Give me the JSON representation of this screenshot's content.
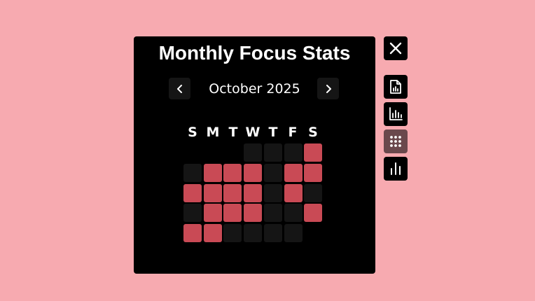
{
  "title": "Monthly Focus Stats",
  "calendar": {
    "month_label": "October 2025",
    "prev_icon": "chevron-left-icon",
    "next_icon": "chevron-right-icon",
    "weekdays": [
      "S",
      "M",
      "T",
      "W",
      "T",
      "F",
      "S"
    ],
    "first_weekday_index": 3,
    "days_in_month": 31,
    "active_days": [
      4,
      6,
      7,
      8,
      10,
      11,
      12,
      13,
      14,
      15,
      17,
      20,
      21,
      22,
      25,
      26,
      27
    ],
    "colors": {
      "active": "#c94a55",
      "inactive": "#151515"
    }
  },
  "side_toolbar": {
    "close_icon": "close-icon",
    "items": [
      {
        "icon": "file-chart-icon",
        "selected": false
      },
      {
        "icon": "bar-chart-icon",
        "selected": false
      },
      {
        "icon": "grid-dots-icon",
        "selected": true
      },
      {
        "icon": "stats-bars-icon",
        "selected": false
      }
    ]
  },
  "colors": {
    "background": "#f7aab0",
    "panel": "#000000",
    "accent": "#c94a55",
    "selected_tool": "#6a484c"
  }
}
